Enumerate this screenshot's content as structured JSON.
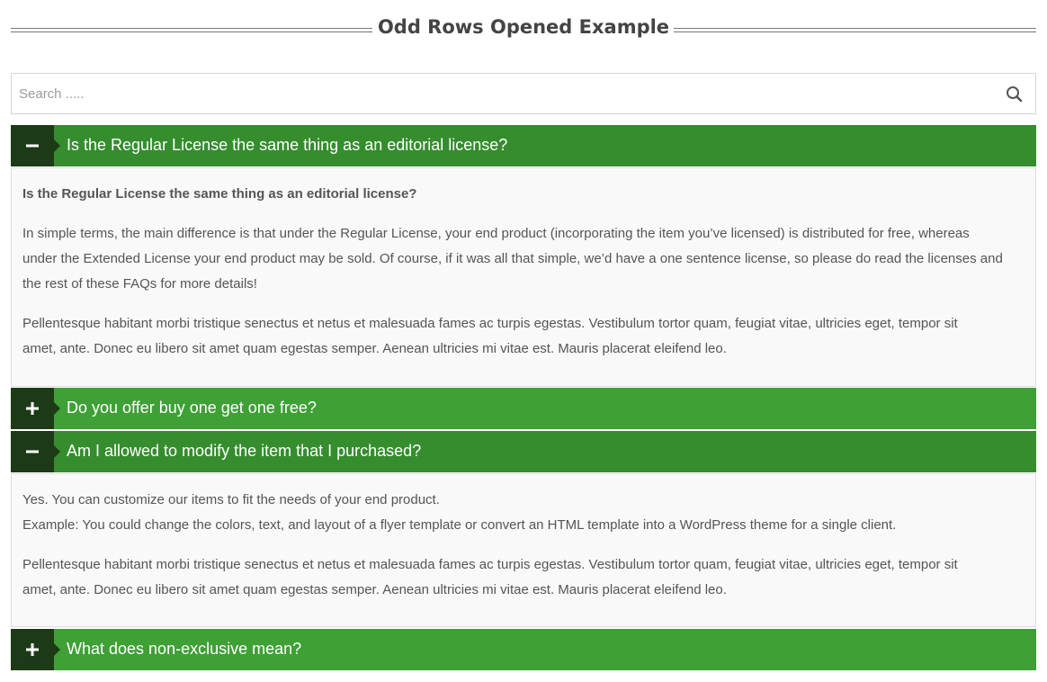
{
  "page_title": "Odd Rows Opened Example",
  "search": {
    "placeholder": "Search ....."
  },
  "accordion": [
    {
      "title": "Is the Regular License the same thing as an editorial license?",
      "open": true,
      "body": {
        "heading": "Is the Regular License the same thing as an editorial license?",
        "para1_line1": "In simple terms, the main difference is that under the Regular License, your end product (incorporating the item you’ve licensed) is distributed for free, whereas",
        "para1_line2": "under the Extended License your end product may be sold. Of course, if it was all that simple, we’d have a one sentence license, so please do read the licenses and",
        "para1_line3": "the rest of these FAQs for more details!",
        "para2_line1": "Pellentesque habitant morbi tristique senectus et netus et malesuada fames ac turpis egestas. Vestibulum tortor quam, feugiat vitae, ultricies eget, tempor sit",
        "para2_line2": "amet, ante. Donec eu libero sit amet quam egestas semper. Aenean ultricies mi vitae est. Mauris placerat eleifend leo."
      }
    },
    {
      "title": "Do you offer buy one get one free?",
      "open": false
    },
    {
      "title": "Am I allowed to modify the item that I purchased?",
      "open": true,
      "body": {
        "line1": "Yes. You can customize our items to fit the needs of your end product.",
        "line2": "Example: You could change the colors, text, and layout of a flyer template or convert an HTML template into a WordPress theme for a single client.",
        "para2_line1": "Pellentesque habitant morbi tristique senectus et netus et malesuada fames ac turpis egestas. Vestibulum tortor quam, feugiat vitae, ultricies eget, tempor sit",
        "para2_line2": "amet, ante. Donec eu libero sit amet quam egestas semper. Aenean ultricies mi vitae est. Mauris placerat eleifend leo."
      }
    },
    {
      "title": "What does non-exclusive mean?",
      "open": false
    }
  ],
  "colors": {
    "header_closed": "#3ea035",
    "header_open": "#358d2e",
    "toggle_bg": "#1d3a17",
    "body_bg": "#f9f9f9"
  },
  "icons": {
    "search": "search-icon",
    "expanded": "minus-icon",
    "collapsed": "plus-icon"
  }
}
